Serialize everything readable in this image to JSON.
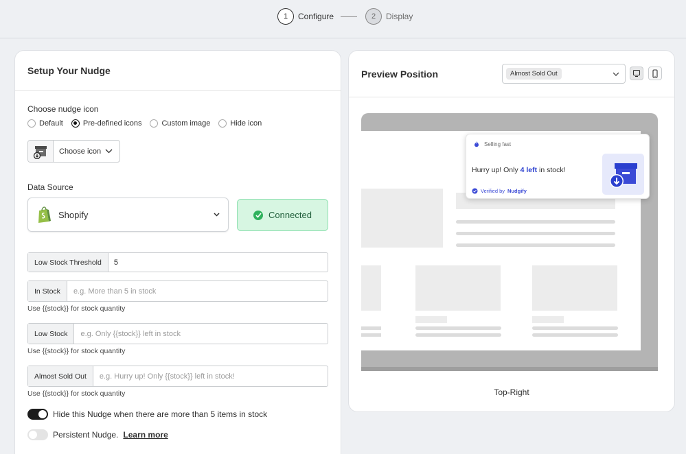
{
  "stepper": {
    "steps": [
      {
        "num": "1",
        "label": "Configure"
      },
      {
        "num": "2",
        "label": "Display"
      }
    ]
  },
  "setup": {
    "title": "Setup Your Nudge",
    "icon_section_label": "Choose nudge icon",
    "icon_options": [
      "Default",
      "Pre-defined icons",
      "Custom image",
      "Hide icon"
    ],
    "icon_selected": "Pre-defined icons",
    "choose_icon_label": "Choose icon",
    "data_source_label": "Data Source",
    "data_source_value": "Shopify",
    "connected_label": "Connected",
    "fields": [
      {
        "prefix": "Low Stock Threshold",
        "value": "5",
        "placeholder": ""
      },
      {
        "prefix": "In Stock",
        "value": "",
        "placeholder": "e.g. More than 5 in stock",
        "hint": "Use {{stock}} for stock quantity"
      },
      {
        "prefix": "Low Stock",
        "value": "",
        "placeholder": "e.g. Only {{stock}} left in stock",
        "hint": "Use {{stock}} for stock quantity"
      },
      {
        "prefix": "Almost Sold Out",
        "value": "",
        "placeholder": "e.g. Hurry up! Only {{stock}} left in stock!",
        "hint": "Use {{stock}} for stock quantity"
      }
    ],
    "toggle_hide": {
      "label": "Hide this Nudge when there are more than 5 items in stock",
      "on": true
    },
    "toggle_persistent": {
      "label": "Persistent Nudge.",
      "link": "Learn more",
      "on": false
    }
  },
  "preview": {
    "title": "Preview Position",
    "select_value": "Almost Sold Out",
    "nudge": {
      "eyebrow": "Selling fast",
      "msg_pre": "Hurry up! Only ",
      "msg_strong": "4 left",
      "msg_post": " in stock!",
      "verified_pre": "Verified by ",
      "verified_brand": "Nudgify"
    },
    "position_label": "Top-Right"
  },
  "colors": {
    "accent_blue": "#2a3fcf",
    "connected_green": "#2fb25d",
    "shopify_green": "#5e8e3e"
  }
}
